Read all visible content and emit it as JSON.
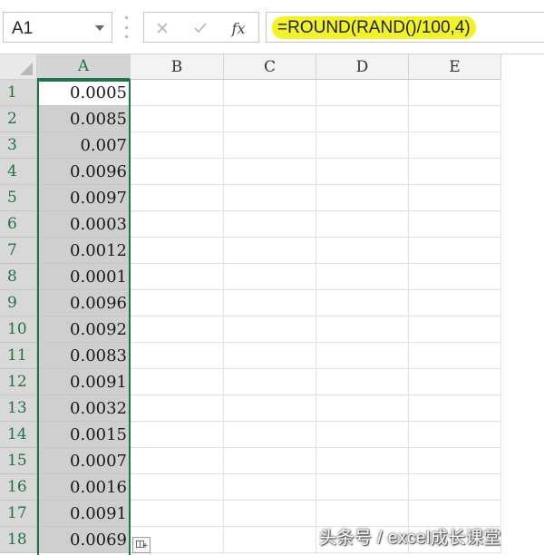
{
  "formula_bar": {
    "name_box": "A1",
    "cancel_icon": "x-icon",
    "enter_icon": "check-icon",
    "fx_label": "fx",
    "formula": "=ROUND(RAND()/100,4)",
    "highlight_color": "#f2f22a"
  },
  "columns": [
    "A",
    "B",
    "C",
    "D",
    "E"
  ],
  "selected_column": "A",
  "rows": [
    {
      "num": "1",
      "a": "0.0005"
    },
    {
      "num": "2",
      "a": "0.0085"
    },
    {
      "num": "3",
      "a": "0.007"
    },
    {
      "num": "4",
      "a": "0.0096"
    },
    {
      "num": "5",
      "a": "0.0097"
    },
    {
      "num": "6",
      "a": "0.0003"
    },
    {
      "num": "7",
      "a": "0.0012"
    },
    {
      "num": "8",
      "a": "0.0001"
    },
    {
      "num": "9",
      "a": "0.0096"
    },
    {
      "num": "10",
      "a": "0.0092"
    },
    {
      "num": "11",
      "a": "0.0083"
    },
    {
      "num": "12",
      "a": "0.0091"
    },
    {
      "num": "13",
      "a": "0.0032"
    },
    {
      "num": "14",
      "a": "0.0015"
    },
    {
      "num": "15",
      "a": "0.0007"
    },
    {
      "num": "16",
      "a": "0.0016"
    },
    {
      "num": "17",
      "a": "0.0091"
    },
    {
      "num": "18",
      "a": "0.0069"
    }
  ],
  "colors": {
    "accent": "#217346",
    "selection_fill": "#cfcfcf"
  },
  "watermark": "头条号 / excel成长课堂"
}
